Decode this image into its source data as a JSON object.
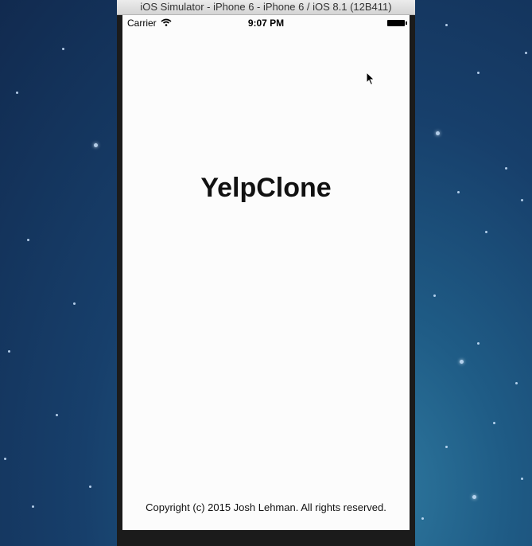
{
  "window": {
    "title": "iOS Simulator - iPhone 6 - iPhone 6 / iOS 8.1 (12B411)"
  },
  "status_bar": {
    "carrier": "Carrier",
    "time": "9:07 PM"
  },
  "app": {
    "title": "YelpClone",
    "footer": "Copyright (c) 2015 Josh Lehman. All rights reserved."
  },
  "icons": [
    "wifi-icon",
    "battery-icon",
    "mouse-cursor-icon"
  ],
  "colors": {
    "screen_bg": "#fcfcfc",
    "text": "#111111",
    "desktop": "#173f6b"
  }
}
